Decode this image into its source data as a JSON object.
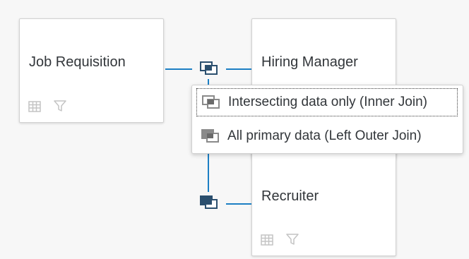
{
  "cards": {
    "job_requisition": {
      "title": "Job Requisition"
    },
    "hiring_manager": {
      "title": "Hiring Manager"
    },
    "recruiter": {
      "title": "Recruiter"
    }
  },
  "join_menu": {
    "items": [
      {
        "label": "Intersecting data only (Inner Join)",
        "icon": "inner-join-icon"
      },
      {
        "label": "All primary data (Left Outer Join)",
        "icon": "left-outer-join-icon"
      }
    ]
  },
  "icons": {
    "table": "table-icon",
    "filter": "filter-icon",
    "join": "join-type-icon"
  },
  "colors": {
    "connector": "#1c7fc4",
    "join_icon": "#2b4f6e",
    "card_border": "#d2d2d2",
    "icon_gray": "#c4c4c4"
  }
}
